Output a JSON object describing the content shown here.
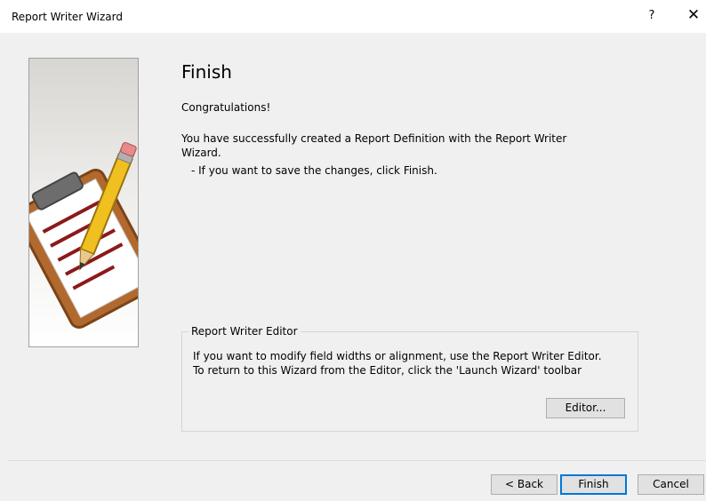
{
  "window": {
    "title": "Report Writer Wizard",
    "help_label": "?",
    "close_label": "✕"
  },
  "main": {
    "heading": "Finish",
    "congrats": "Congratulations!",
    "message": "You have successfully created a Report Definition with the Report Writer Wizard.",
    "hint": "- If you want to save the changes, click Finish."
  },
  "editor_group": {
    "legend": "Report Writer Editor",
    "line1": "If you want to modify field widths or alignment, use the Report Writer Editor.",
    "line2": "To return to this Wizard from the Editor, click the 'Launch Wizard' toolbar",
    "editor_button": "Editor..."
  },
  "footer": {
    "back": "< Back",
    "finish": "Finish",
    "cancel": "Cancel"
  },
  "colors": {
    "accent": "#0078d7",
    "clipboard": "#b2692e",
    "pencil": "#f0c020"
  }
}
